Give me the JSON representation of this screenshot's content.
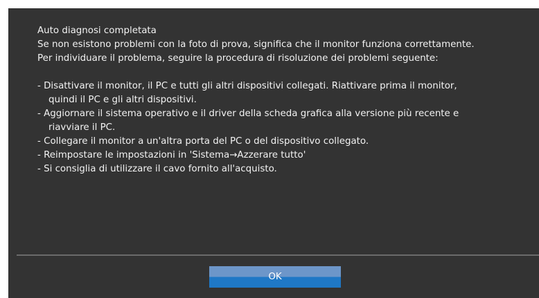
{
  "dialog": {
    "title": "Auto diagnosi completata",
    "lines": [
      "Se non esistono problemi con la foto di prova, significa che il monitor funziona correttamente.",
      "Per individuare il problema, seguire la procedura di risoluzione dei problemi seguente:"
    ],
    "steps": [
      {
        "text": "- Disattivare il monitor, il PC e tutti gli altri dispositivi collegati. Riattivare prima il monitor,",
        "continuation": "quindi il PC e gli altri dispositivi."
      },
      {
        "text": "- Aggiornare il sistema operativo e il driver della scheda grafica alla versione più recente e",
        "continuation": "riavviare il PC."
      },
      {
        "text": "- Collegare il monitor a un'altra porta del PC o del dispositivo collegato.",
        "continuation": ""
      },
      {
        "text": "- Reimpostare le impostazioni in 'Sistema→Azzerare tutto'",
        "continuation": ""
      },
      {
        "text": "- Si consiglia di utilizzare il cavo fornito all'acquisto.",
        "continuation": ""
      }
    ],
    "ok_label": "OK"
  },
  "colors": {
    "dialog_background": "#333333",
    "text": "#f2f2f2",
    "divider": "#6b6b6b",
    "button_top": "#6d96c9",
    "button_bottom": "#1f78c6"
  }
}
